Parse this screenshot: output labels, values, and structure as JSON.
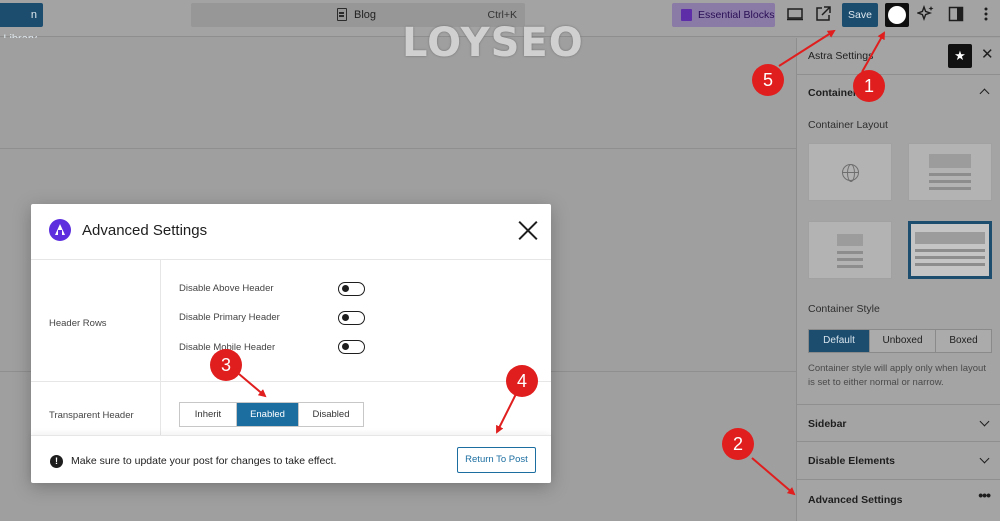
{
  "toolbar": {
    "library_label": "n Library",
    "command_bar_title": "Blog",
    "command_bar_shortcut": "Ctrl+K",
    "essential_blocks_label": "Essential Blocks",
    "save_label": "Save"
  },
  "sidebar": {
    "panel_title": "Astra Settings",
    "container_section_label": "Container",
    "container_layout_label": "Container Layout",
    "container_style_label": "Container Style",
    "container_style_options": [
      "Default",
      "Unboxed",
      "Boxed"
    ],
    "container_style_selected": "Default",
    "container_style_help": [
      "Container style will apply only when layout",
      "is set to either normal or narrow."
    ],
    "sections": [
      "Sidebar",
      "Disable Elements",
      "Advanced Settings"
    ]
  },
  "modal": {
    "title": "Advanced Settings",
    "header_rows_label": "Header Rows",
    "header_options": [
      "Disable Above Header",
      "Disable Primary Header",
      "Disable Mobile Header"
    ],
    "transparent_header_label": "Transparent Header",
    "transparent_options": [
      "Inherit",
      "Enabled",
      "Disabled"
    ],
    "transparent_selected": "Enabled",
    "footer_message": "Make sure to update your post for changes to take effect.",
    "return_button_label": "Return To Post"
  },
  "watermark": "LOYSEO",
  "annotations": [
    "1",
    "2",
    "3",
    "4",
    "5"
  ],
  "colors": {
    "accent": "#1c4d6f",
    "modal_accent": "#1c6ea1",
    "astra_purple": "#5c2ede",
    "annotation_red": "#e01e1e"
  }
}
